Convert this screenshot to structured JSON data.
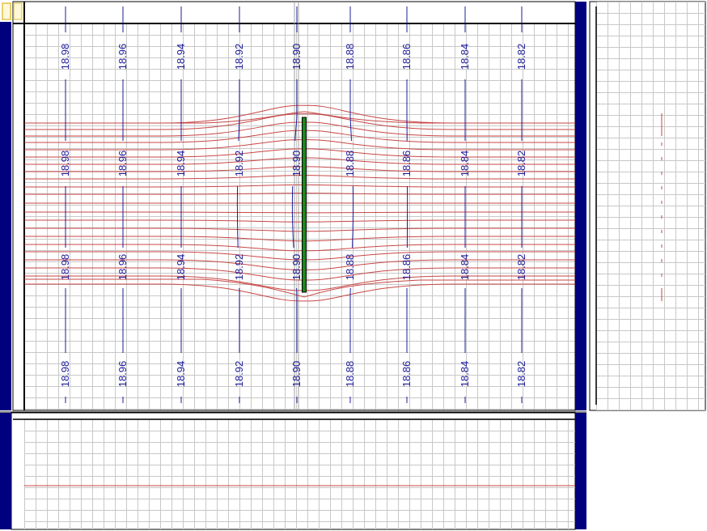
{
  "colors": {
    "background": "#ffffff",
    "grid": "#c8c8c8",
    "frame_bar": "#00007f",
    "contour": "#1d1d9a",
    "streamline": "#c84646",
    "wall": "#1b8a1b",
    "frame_border": "#000000",
    "handle": "#e8d070"
  },
  "contour_labels": [
    "18.98",
    "18.96",
    "18.94",
    "18.92",
    "18.90",
    "18.88",
    "18.86",
    "18.84",
    "18.82"
  ],
  "section_marker_count": 13,
  "handle_icon": "square-handle-icon"
}
